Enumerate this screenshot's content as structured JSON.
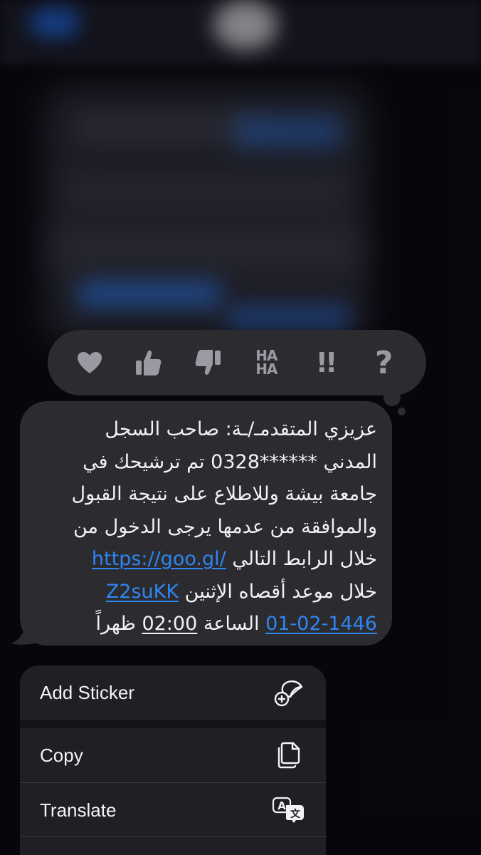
{
  "reactions": [
    {
      "name": "heart",
      "label": ""
    },
    {
      "name": "thumbs-up",
      "label": ""
    },
    {
      "name": "thumbs-down",
      "label": ""
    },
    {
      "name": "haha",
      "label_top": "HA",
      "label_bottom": "HA"
    },
    {
      "name": "exclamation",
      "label": "!!"
    },
    {
      "name": "question",
      "label": "?"
    }
  ],
  "message": {
    "line1": "عزيزي المتقدمـ/ـة: صاحب السجل",
    "line2": "المدني ******0328 تم ترشيحك في",
    "line3": "جامعة بيشة وللاطلاع على نتيجة القبول",
    "line4": "والموافقة من عدمها يرجى الدخول من",
    "line5_text": "خلال الرابط التالي",
    "link_part1": "https://goo.gl/",
    "link_part2": "Z2suKK",
    "line6_text": "خلال موعد أقصاه الإثنين",
    "date_link": "01-02-1446",
    "line7_mid": "الساعة",
    "time": "02:00",
    "line7_end": "ظهراً"
  },
  "menu": {
    "items": [
      {
        "label": "Add Sticker",
        "icon": "sticker-add-icon"
      },
      {
        "label": "Copy",
        "icon": "copy-icon"
      },
      {
        "label": "Translate",
        "icon": "translate-icon"
      }
    ]
  },
  "colors": {
    "bubble": "#2b2b30",
    "link": "#2f86f0",
    "menu": "#1f1f24",
    "icon_gray": "#9a9aa2"
  }
}
